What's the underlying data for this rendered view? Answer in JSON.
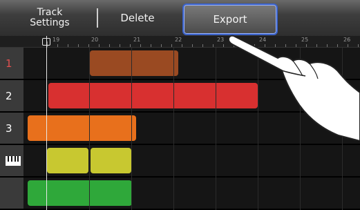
{
  "toolbar": {
    "track_settings_line1": "Track",
    "track_settings_line2": "Settings",
    "delete_label": "Delete",
    "export_label": "Export"
  },
  "ruler": {
    "markers": [
      "19",
      "20",
      "21",
      "22",
      "23",
      "24",
      "25",
      "26"
    ]
  },
  "tracks": [
    {
      "label": "1",
      "color": "#9a4a22"
    },
    {
      "label": "2",
      "color": "#d83030"
    },
    {
      "label": "3",
      "color": "#e8701c"
    },
    {
      "label": "",
      "icon": "piano-icon",
      "color": "#c8c830"
    },
    {
      "label": "",
      "color": "#2fa83a"
    }
  ],
  "colors": {
    "accent": "#3b62c8"
  }
}
